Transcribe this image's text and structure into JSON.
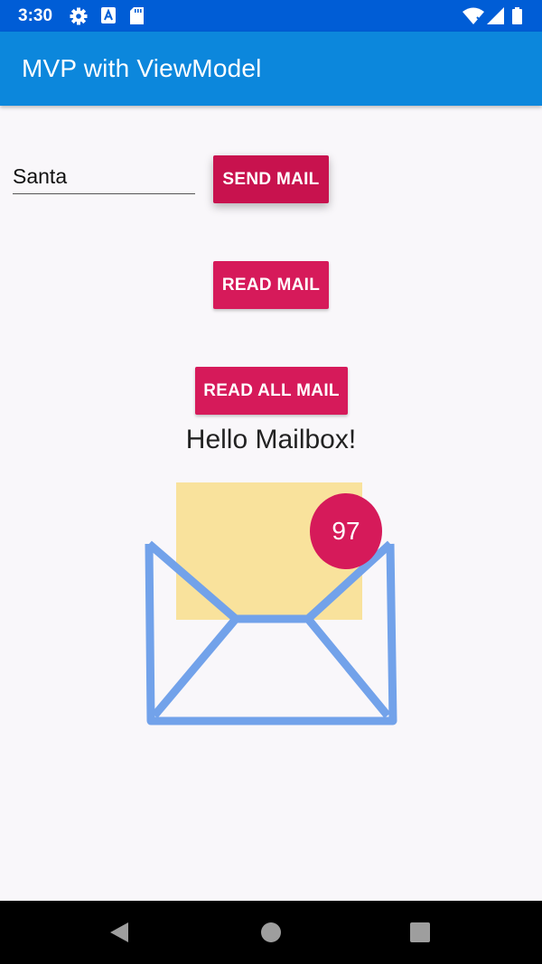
{
  "status_bar": {
    "time": "3:30",
    "icons": [
      "gear-icon",
      "a-icon",
      "sd-card-icon",
      "wifi-icon",
      "signal-icon",
      "battery-icon"
    ]
  },
  "app_bar": {
    "title": "MVP with ViewModel"
  },
  "form": {
    "name_value": "Santa",
    "send_label": "SEND MAIL",
    "read_label": "READ MAIL",
    "read_all_label": "READ ALL MAIL"
  },
  "mailbox": {
    "greeting": "Hello Mailbox!",
    "count": "97"
  },
  "nav_bar": {
    "icons": [
      "back-icon",
      "home-icon",
      "recents-icon"
    ]
  },
  "colors": {
    "status_bar": "#005dd6",
    "app_bar": "#0c87dc",
    "accent": "#d61a5a",
    "envelope_stroke": "#72a2ea",
    "letter_fill": "#f9e29c"
  }
}
